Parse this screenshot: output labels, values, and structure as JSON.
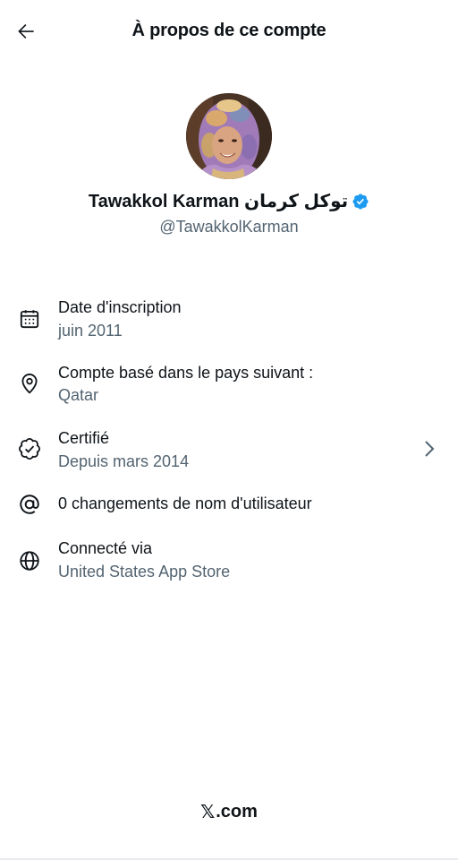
{
  "header": {
    "title": "À propos de ce compte",
    "back_icon": "arrow-left-icon"
  },
  "profile": {
    "name": "Tawakkol Karman توكل كرمان",
    "handle": "@TawakkolKarman",
    "verified": true,
    "verified_color": "#1d9bf0"
  },
  "info": [
    {
      "icon": "calendar-icon",
      "label": "Date d'inscription",
      "value": "juin 2011"
    },
    {
      "icon": "location-pin-icon",
      "label": "Compte basé dans le pays suivant :",
      "value": "Qatar"
    },
    {
      "icon": "verified-outline-icon",
      "label": "Certifié",
      "value": "Depuis mars 2014",
      "has_chevron": true
    },
    {
      "icon": "at-sign-icon",
      "label": "0 changements de nom d'utilisateur"
    },
    {
      "icon": "globe-icon",
      "label": "Connecté via",
      "value": "United States App Store"
    }
  ],
  "footer": {
    "brand_glyph": "𝕏",
    "domain": ".com"
  },
  "colors": {
    "text_primary": "#0f1419",
    "text_secondary": "#536471",
    "accent": "#1d9bf0"
  }
}
